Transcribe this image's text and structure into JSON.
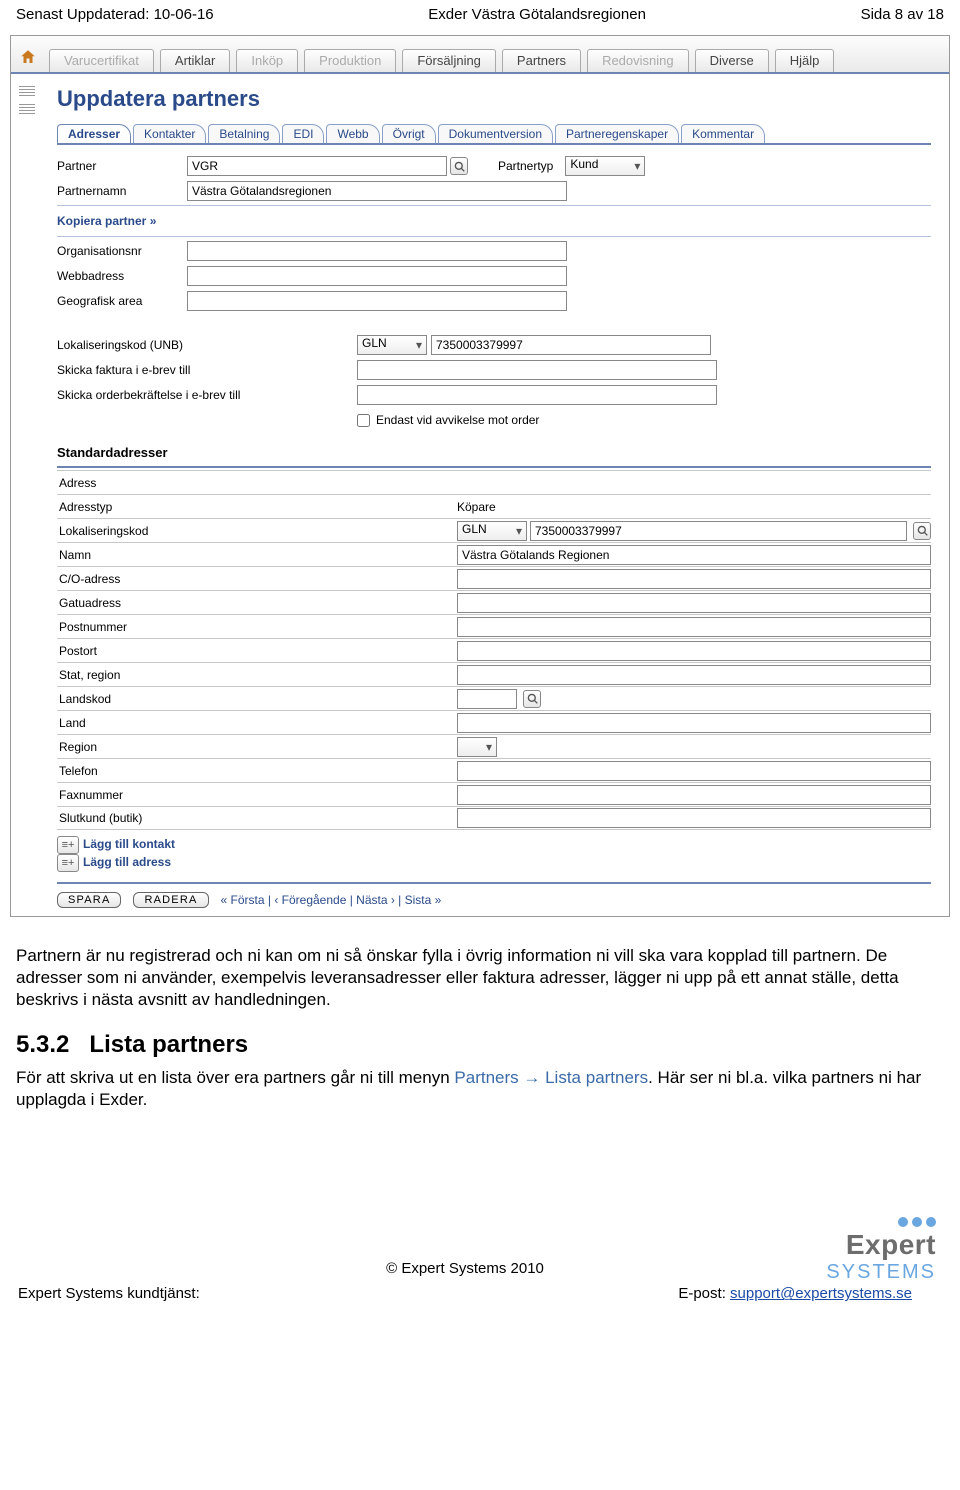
{
  "doc": {
    "header_left": "Senast Uppdaterad: 10-06-16",
    "header_center": "Exder Västra Götalandsregionen",
    "header_right": "Sida 8 av 18",
    "para1": "Partnern är nu registrerad och ni kan om ni så önskar fylla i övrig information ni vill ska vara kopplad till partnern. De adresser som ni använder, exempelvis leveransadresser eller faktura adresser, lägger ni upp på ett annat ställe, detta beskrivs i nästa avsnitt av handledningen.",
    "h3_num": "5.3.2",
    "h3_title": "Lista partners",
    "para2_a": "För att skriva ut en lista över era partners går ni till menyn ",
    "para2_menu": "Partners → Lista partners",
    "para2_b": ". Här ser ni bl.a. vilka partners ni har upplagda i Exder.",
    "footer_copy": "© Expert Systems 2010",
    "footer_left": "Expert Systems kundtjänst:",
    "footer_right_label": "E-post: ",
    "footer_email": "support@expertsystems.se",
    "logo_brand": "Expert",
    "logo_sys": "SYSTEMS"
  },
  "topnav": [
    {
      "label": "Varucertifikat",
      "disabled": true
    },
    {
      "label": "Artiklar",
      "disabled": false
    },
    {
      "label": "Inköp",
      "disabled": true
    },
    {
      "label": "Produktion",
      "disabled": true
    },
    {
      "label": "Försäljning",
      "disabled": false
    },
    {
      "label": "Partners",
      "disabled": false
    },
    {
      "label": "Redovisning",
      "disabled": true
    },
    {
      "label": "Diverse",
      "disabled": false
    },
    {
      "label": "Hjälp",
      "disabled": false
    }
  ],
  "page_title": "Uppdatera partners",
  "subtabs": [
    "Adresser",
    "Kontakter",
    "Betalning",
    "EDI",
    "Webb",
    "Övrigt",
    "Dokumentversion",
    "Partneregenskaper",
    "Kommentar"
  ],
  "subtab_active_index": 0,
  "partner": {
    "labels": {
      "partner": "Partner",
      "partnertyp": "Partnertyp",
      "partnernamn": "Partnernamn",
      "kopiera": "Kopiera partner »",
      "org": "Organisationsnr",
      "webb": "Webbadress",
      "geo": "Geografisk area",
      "lokaliser": "Lokaliseringskod (UNB)",
      "ebrev": "Skicka faktura i e-brev till",
      "orderbekr": "Skicka orderbekräftelse i e-brev till",
      "endast": "Endast vid avvikelse mot order"
    },
    "values": {
      "partner": "VGR",
      "partnertyp": "Kund",
      "partnernamn": "Västra Götalandsregionen",
      "org": "",
      "webb": "",
      "geo": "",
      "lokaliser_type": "GLN",
      "lokaliser_code": "7350003379997",
      "ebrev": "",
      "orderbekr": "",
      "endast_checked": false
    }
  },
  "standardadresser": {
    "heading": "Standardadresser",
    "rows": [
      {
        "label": "Adress",
        "type": "header"
      },
      {
        "label": "Adresstyp",
        "type": "text",
        "value": "Köpare"
      },
      {
        "label": "Lokaliseringskod",
        "type": "loc",
        "sel": "GLN",
        "code": "7350003379997"
      },
      {
        "label": "Namn",
        "type": "input",
        "value": "Västra Götalands Regionen"
      },
      {
        "label": "C/O-adress",
        "type": "input",
        "value": ""
      },
      {
        "label": "Gatuadress",
        "type": "input",
        "value": ""
      },
      {
        "label": "Postnummer",
        "type": "input",
        "value": ""
      },
      {
        "label": "Postort",
        "type": "input",
        "value": ""
      },
      {
        "label": "Stat, region",
        "type": "input",
        "value": ""
      },
      {
        "label": "Landskod",
        "type": "search",
        "value": ""
      },
      {
        "label": "Land",
        "type": "input",
        "value": ""
      },
      {
        "label": "Region",
        "type": "select",
        "value": ""
      },
      {
        "label": "Telefon",
        "type": "input",
        "value": ""
      },
      {
        "label": "Faxnummer",
        "type": "input",
        "value": ""
      },
      {
        "label": "Slutkund (butik)",
        "type": "input",
        "value": ""
      }
    ],
    "add_links": {
      "kontakt": "Lägg till kontakt",
      "adress": "Lägg till adress"
    }
  },
  "bottombar": {
    "save": "SPARA",
    "delete": "RADERA",
    "nav": "« Första  |  ‹ Föregående  |  Nästa ›  |  Sista »"
  }
}
